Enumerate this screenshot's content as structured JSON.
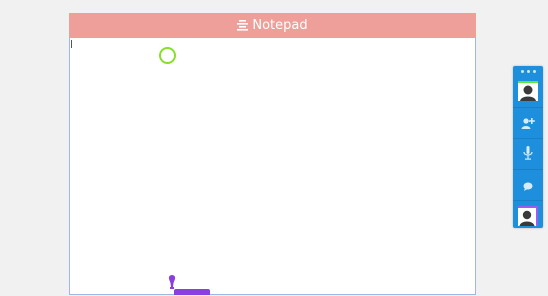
{
  "notepad": {
    "title": "Notepad",
    "title_icon": "menu-lines-icon",
    "header_color": "#ef9f99",
    "border_color": "#9fb7e3"
  },
  "canvas": {
    "cursor_color": "#88e02a",
    "tab_color": "#8a3fe0"
  },
  "toolbar": {
    "background": "#1e8fdc",
    "items": [
      {
        "name": "user-avatar",
        "icon": "user-avatar-icon",
        "accent": "#5ee83a"
      },
      {
        "name": "add-user",
        "icon": "add-user-icon"
      },
      {
        "name": "microphone",
        "icon": "microphone-icon"
      },
      {
        "name": "chat",
        "icon": "chat-bubble-icon"
      },
      {
        "name": "participant-avatar",
        "icon": "user-avatar-icon",
        "accent": "#9b5cf0"
      }
    ]
  }
}
